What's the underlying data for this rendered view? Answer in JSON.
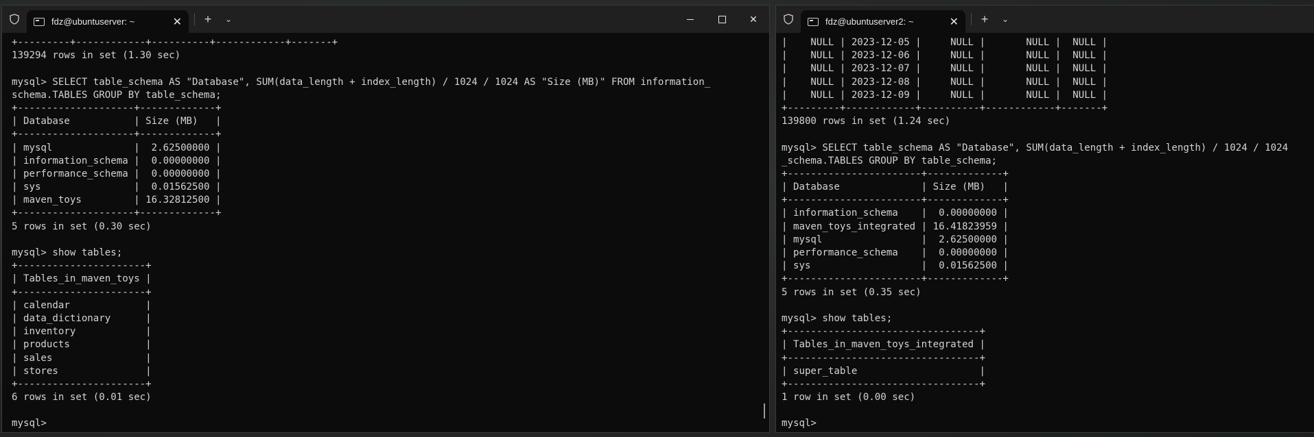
{
  "window1": {
    "tab_title": "fdz@ubuntuserver: ~",
    "terminal_lines": [
      "+---------+------------+----------+------------+-------+",
      "139294 rows in set (1.30 sec)",
      "",
      "mysql> SELECT table_schema AS \"Database\", SUM(data_length + index_length) / 1024 / 1024 AS \"Size (MB)\" FROM information_",
      "schema.TABLES GROUP BY table_schema;",
      "+--------------------+-------------+",
      "| Database           | Size (MB)   |",
      "+--------------------+-------------+",
      "| mysql              |  2.62500000 |",
      "| information_schema |  0.00000000 |",
      "| performance_schema |  0.00000000 |",
      "| sys                |  0.01562500 |",
      "| maven_toys         | 16.32812500 |",
      "+--------------------+-------------+",
      "5 rows in set (0.30 sec)",
      "",
      "mysql> show tables;",
      "+----------------------+",
      "| Tables_in_maven_toys |",
      "+----------------------+",
      "| calendar             |",
      "| data_dictionary      |",
      "| inventory            |",
      "| products             |",
      "| sales                |",
      "| stores               |",
      "+----------------------+",
      "6 rows in set (0.01 sec)",
      "",
      "mysql>"
    ]
  },
  "window2": {
    "tab_title": "fdz@ubuntuserver2: ~",
    "terminal_lines": [
      "|    NULL | 2023-12-05 |     NULL |       NULL |  NULL |",
      "|    NULL | 2023-12-06 |     NULL |       NULL |  NULL |",
      "|    NULL | 2023-12-07 |     NULL |       NULL |  NULL |",
      "|    NULL | 2023-12-08 |     NULL |       NULL |  NULL |",
      "|    NULL | 2023-12-09 |     NULL |       NULL |  NULL |",
      "+---------+------------+----------+------------+-------+",
      "139800 rows in set (1.24 sec)",
      "",
      "mysql> SELECT table_schema AS \"Database\", SUM(data_length + index_length) / 1024 / 1024",
      "_schema.TABLES GROUP BY table_schema;",
      "+-----------------------+-------------+",
      "| Database              | Size (MB)   |",
      "+-----------------------+-------------+",
      "| information_schema    |  0.00000000 |",
      "| maven_toys_integrated | 16.41823959 |",
      "| mysql                 |  2.62500000 |",
      "| performance_schema    |  0.00000000 |",
      "| sys                   |  0.01562500 |",
      "+-----------------------+-------------+",
      "5 rows in set (0.35 sec)",
      "",
      "mysql> show tables;",
      "+---------------------------------+",
      "| Tables_in_maven_toys_integrated |",
      "+---------------------------------+",
      "| super_table                     |",
      "+---------------------------------+",
      "1 row in set (0.00 sec)",
      "",
      "mysql>"
    ]
  },
  "icons": {
    "shield": "shield-icon",
    "terminal": "terminal-icon",
    "close": "close-icon",
    "new_tab": "plus-icon",
    "dropdown": "chevron-down-icon",
    "minimize": "minimize-icon",
    "maximize": "maximize-icon"
  }
}
